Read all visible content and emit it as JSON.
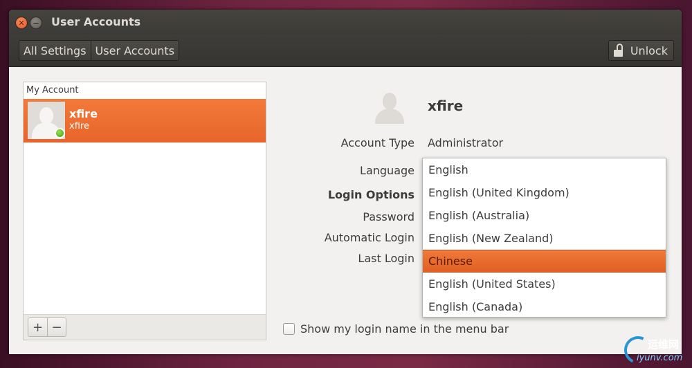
{
  "window": {
    "title": "User Accounts"
  },
  "toolbar": {
    "breadcrumbs": [
      "All Settings",
      "User Accounts"
    ],
    "unlock_label": "Unlock"
  },
  "user_list": {
    "header": "My Account",
    "users": [
      {
        "name": "xfire",
        "username": "xfire",
        "status": "online"
      }
    ],
    "add_label": "+",
    "remove_label": "−"
  },
  "account": {
    "name": "xfire",
    "account_type_label": "Account Type",
    "account_type_value": "Administrator",
    "language_label": "Language",
    "login_options_label": "Login Options",
    "password_label": "Password",
    "automatic_login_label": "Automatic Login",
    "last_login_label": "Last Login"
  },
  "language_dropdown": {
    "options": [
      "English",
      "English (United Kingdom)",
      "English (Australia)",
      "English (New Zealand)",
      "Chinese",
      "English (United States)",
      "English (Canada)"
    ],
    "selected": "Chinese"
  },
  "show_login_name": {
    "label": "Show my login name in the menu bar",
    "checked": false
  },
  "watermark": {
    "cn": "运维网",
    "url": "iyunv.com"
  },
  "colors": {
    "accent": "#e8642a",
    "titlebar": "#3c3b37",
    "background": "#f2f1f0"
  }
}
